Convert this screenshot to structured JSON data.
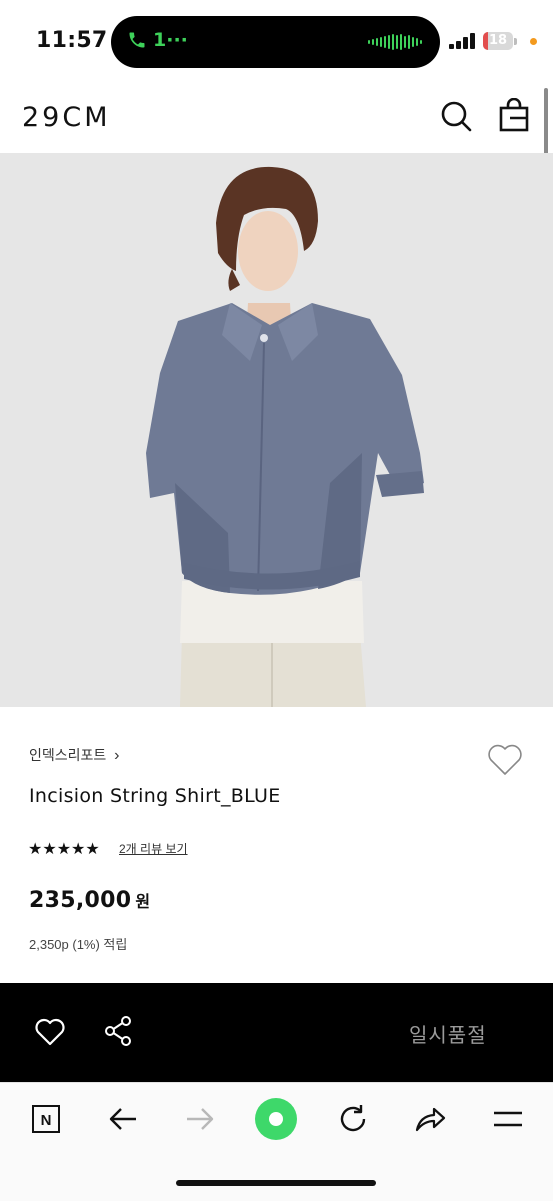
{
  "status_bar": {
    "time": "11:57",
    "call_text": "1···",
    "battery_level": "18",
    "battery_fraction": 0.18,
    "call_color": "#3ed15a",
    "battery_color": "#e24e4e"
  },
  "header": {
    "logo": "29CM",
    "search_icon": "search-icon",
    "bag_icon": "shopping-bag-icon"
  },
  "product": {
    "image_desc_icon": "product-photo",
    "brand": "인덱스리포트",
    "brand_arrow": "›",
    "name": "Incision String Shirt_BLUE",
    "stars": "★★★★★",
    "rating": 5,
    "review_link": "2개 리뷰 보기",
    "price": "235,000",
    "currency": "원",
    "points": "2,350p (1%) 적립"
  },
  "action_bar": {
    "wishlist_icon": "heart-icon",
    "share_icon": "share-icon",
    "status_button": "일시품절"
  },
  "browser_bar": {
    "buttons": [
      "naver-icon",
      "back-arrow-icon",
      "forward-arrow-icon",
      "green-dot-icon",
      "reload-icon",
      "share-arrow-icon",
      "menu-icon"
    ],
    "accent": "#3ed86a"
  }
}
